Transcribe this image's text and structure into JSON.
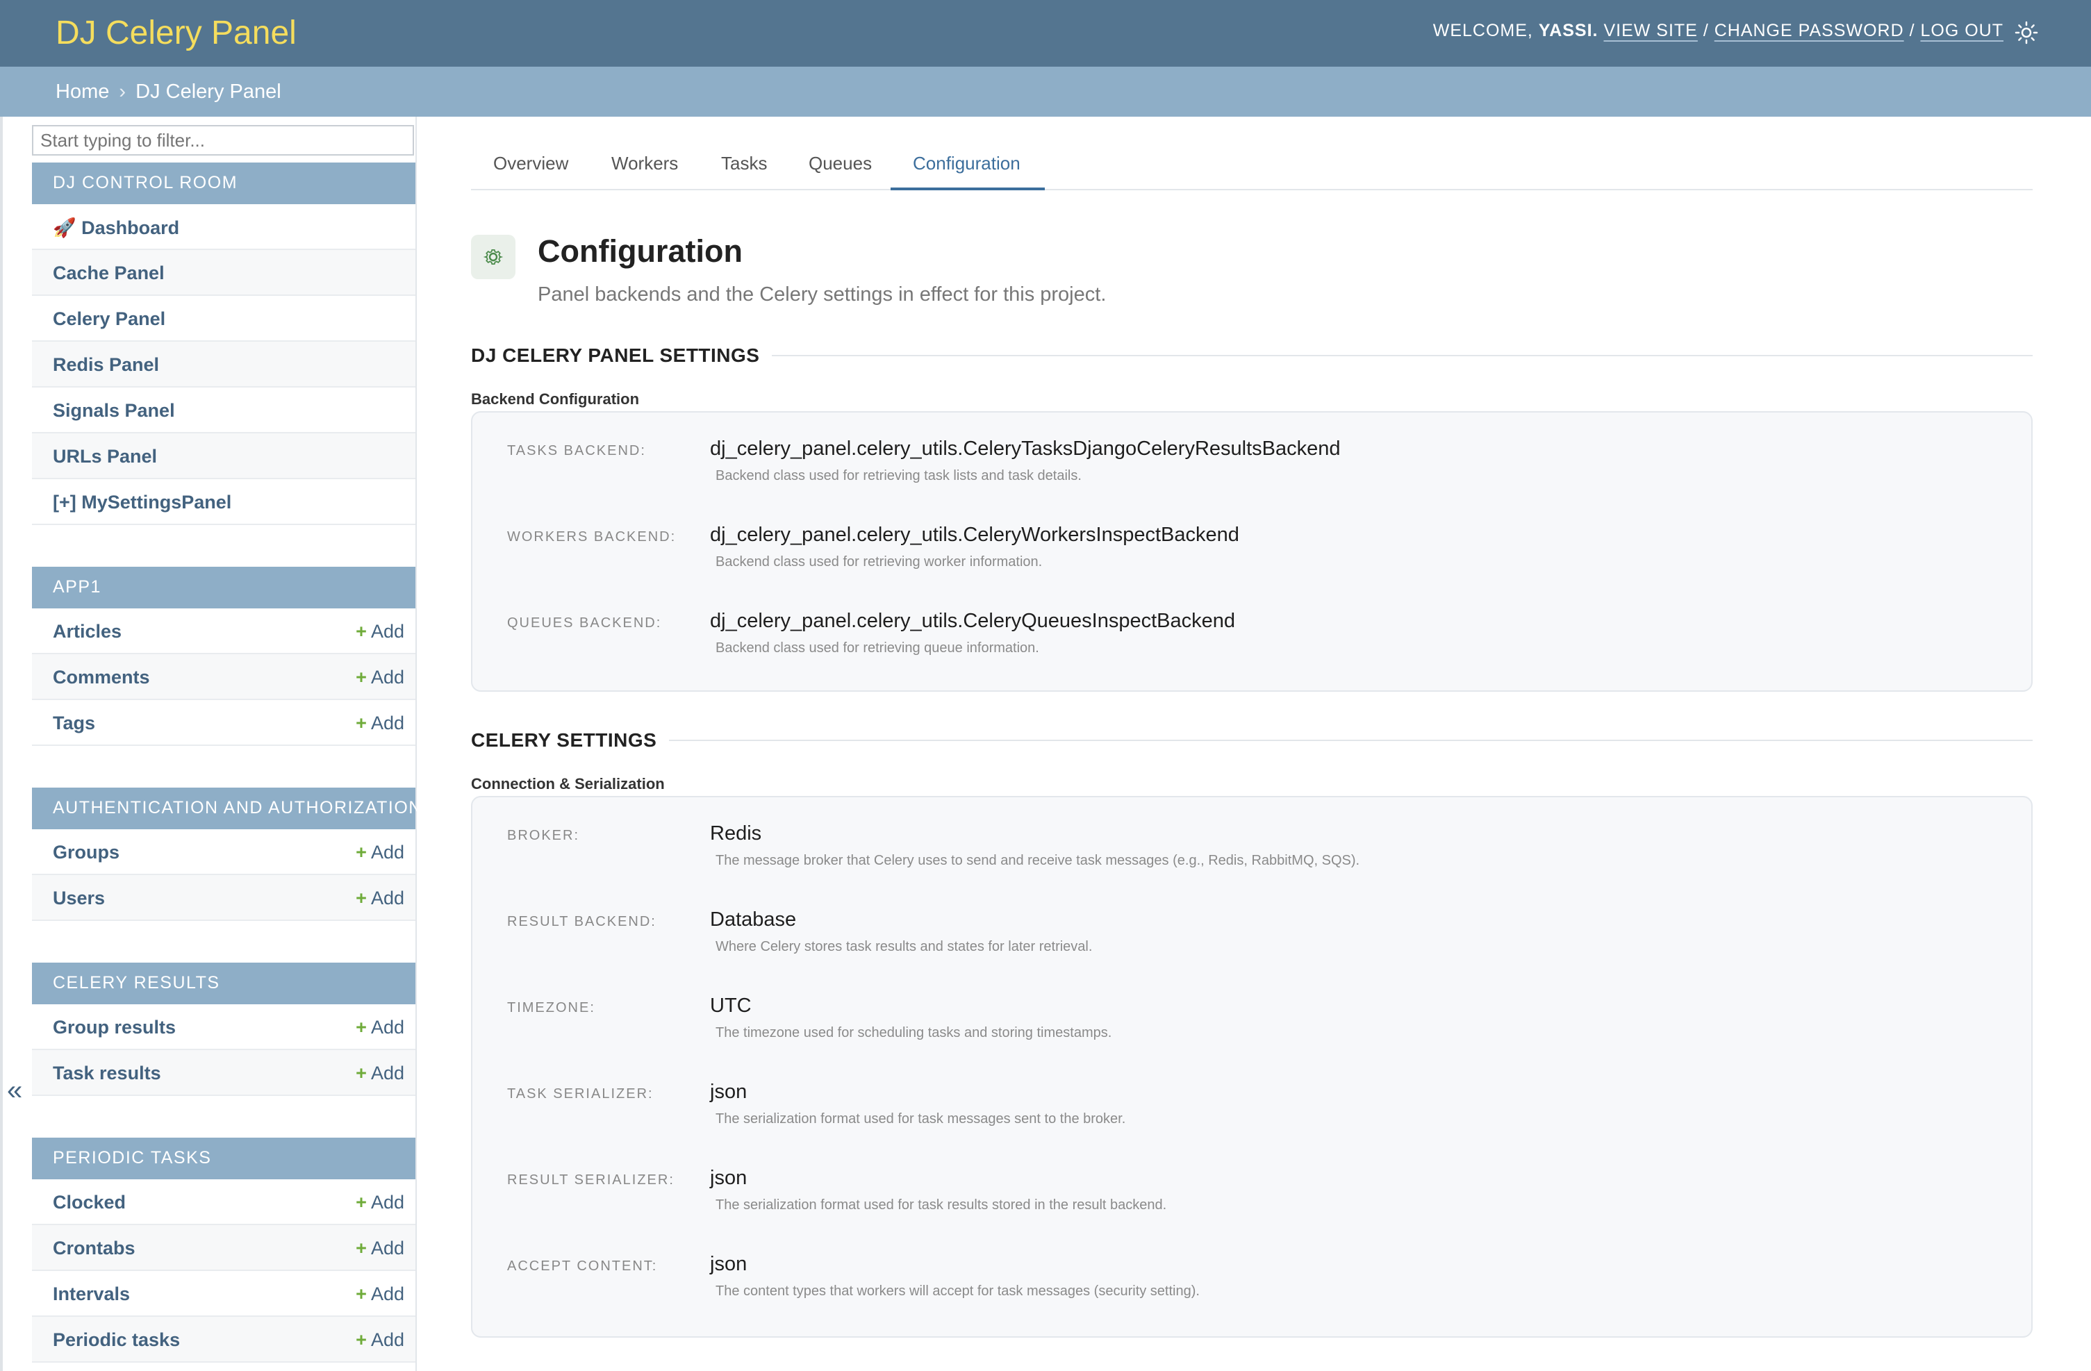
{
  "header": {
    "brand": "DJ Celery Panel",
    "welcome": "Welcome,",
    "username": "yassi.",
    "view_site": "View site",
    "change_password": "Change password",
    "log_out": "Log out",
    "sep": "/"
  },
  "breadcrumb": {
    "home": "Home",
    "sep": "›",
    "current": "DJ Celery Panel"
  },
  "sidebar": {
    "filter_placeholder": "Start typing to filter...",
    "collapse_glyph": "«",
    "add_label": "Add",
    "modules": [
      {
        "title": "DJ Control Room",
        "items": [
          "🚀 Dashboard",
          "Cache Panel",
          "Celery Panel",
          "Redis Panel",
          "Signals Panel",
          "URLs Panel",
          "[+] MySettingsPanel"
        ]
      },
      {
        "title": "App1",
        "items": [
          "Articles",
          "Comments",
          "Tags"
        ]
      },
      {
        "title": "Authentication and Authorization",
        "items": [
          "Groups",
          "Users"
        ]
      },
      {
        "title": "Celery Results",
        "items": [
          "Group results",
          "Task results"
        ]
      },
      {
        "title": "Periodic Tasks",
        "items": [
          "Clocked",
          "Crontabs",
          "Intervals",
          "Periodic tasks"
        ]
      }
    ]
  },
  "tabs": [
    "Overview",
    "Workers",
    "Tasks",
    "Queues",
    "Configuration"
  ],
  "active_tab": "Configuration",
  "page": {
    "title": "Configuration",
    "subtitle": "Panel backends and the Celery settings in effect for this project."
  },
  "sections": [
    {
      "title": "DJ CELERY PANEL SETTINGS",
      "group": "Backend Configuration",
      "items": [
        {
          "key": "Tasks Backend:",
          "value": "dj_celery_panel.celery_utils.CeleryTasksDjangoCeleryResultsBackend",
          "desc": "Backend class used for retrieving task lists and task details."
        },
        {
          "key": "Workers Backend:",
          "value": "dj_celery_panel.celery_utils.CeleryWorkersInspectBackend",
          "desc": "Backend class used for retrieving worker information."
        },
        {
          "key": "Queues Backend:",
          "value": "dj_celery_panel.celery_utils.CeleryQueuesInspectBackend",
          "desc": "Backend class used for retrieving queue information."
        }
      ]
    },
    {
      "title": "CELERY SETTINGS",
      "group": "Connection & Serialization",
      "items": [
        {
          "key": "Broker:",
          "value": "Redis",
          "desc": "The message broker that Celery uses to send and receive task messages (e.g., Redis, RabbitMQ, SQS)."
        },
        {
          "key": "Result Backend:",
          "value": "Database",
          "desc": "Where Celery stores task results and states for later retrieval."
        },
        {
          "key": "Timezone:",
          "value": "UTC",
          "desc": "The timezone used for scheduling tasks and storing timestamps."
        },
        {
          "key": "Task Serializer:",
          "value": "json",
          "desc": "The serialization format used for task messages sent to the broker."
        },
        {
          "key": "Result Serializer:",
          "value": "json",
          "desc": "The serialization format used for task results stored in the result backend."
        },
        {
          "key": "Accept Content:",
          "value": "json",
          "desc": "The content types that workers will accept for task messages (security setting)."
        }
      ]
    }
  ]
}
